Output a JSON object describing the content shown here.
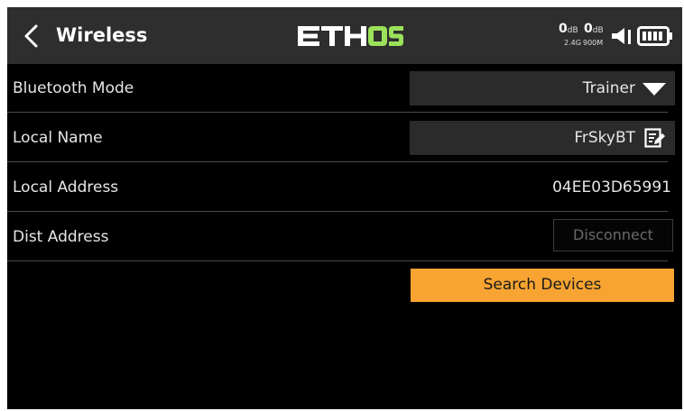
{
  "header": {
    "title": "Wireless",
    "logo_text": "ETHOS",
    "rssi_24_value": "0",
    "rssi_24_unit": "dB",
    "rssi_24_band": "2.4G",
    "rssi_900_value": "0",
    "rssi_900_unit": "dB",
    "rssi_900_band": "900M",
    "icons": [
      "back-chevron-icon",
      "speaker-icon",
      "battery-icon"
    ]
  },
  "settings": {
    "bluetooth_mode": {
      "label": "Bluetooth Mode",
      "value": "Trainer"
    },
    "local_name": {
      "label": "Local Name",
      "value": "FrSkyBT"
    },
    "local_address": {
      "label": "Local Address",
      "value": "04EE03D65991"
    },
    "dist_address": {
      "label": "Dist Address",
      "button": "Disconnect"
    }
  },
  "actions": {
    "search_label": "Search Devices"
  },
  "colors": {
    "accent": "#f7a432",
    "logo_highlight": "#9be25a",
    "background": "#000000",
    "header": "#2e2e2e"
  }
}
